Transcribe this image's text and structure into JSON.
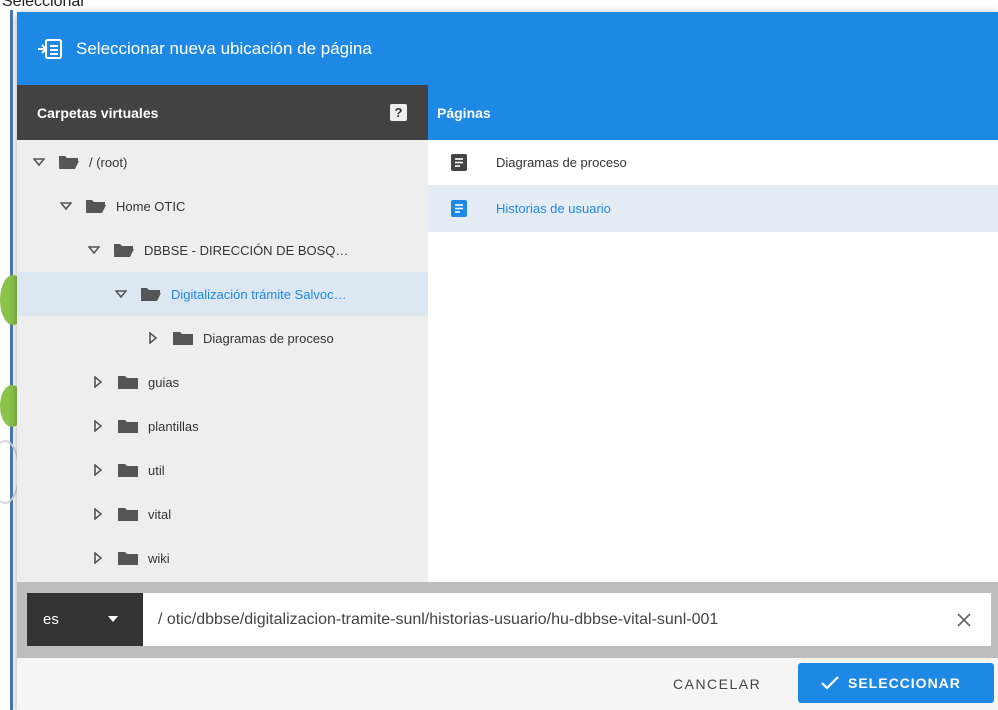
{
  "background": {
    "top_text": "Seleccionar"
  },
  "dialog": {
    "title": "Seleccionar nueva ubicación de página",
    "header_icon": "move-to-icon",
    "accent_color": "#1e88e5",
    "left_panel": {
      "title": "Carpetas virtuales",
      "help_label": "?"
    },
    "tree": [
      {
        "label": "/ (root)",
        "expanded": true,
        "icon": "folder-open-icon"
      },
      {
        "label": "Home OTIC",
        "expanded": true,
        "icon": "folder-open-icon"
      },
      {
        "label": "DBBSE - DIRECCIÓN DE BOSQUES, BI...",
        "expanded": true,
        "icon": "folder-open-icon"
      },
      {
        "label": "Digitalización trámite Salvocondu...",
        "expanded": true,
        "selected": true,
        "icon": "folder-open-icon"
      },
      {
        "label": "Diagramas de proceso",
        "expanded": false,
        "icon": "folder-icon"
      },
      {
        "label": "guias",
        "expanded": false,
        "icon": "folder-icon"
      },
      {
        "label": "plantillas",
        "expanded": false,
        "icon": "folder-icon"
      },
      {
        "label": "util",
        "expanded": false,
        "icon": "folder-icon"
      },
      {
        "label": "vital",
        "expanded": false,
        "icon": "folder-icon"
      },
      {
        "label": "wiki",
        "expanded": false,
        "icon": "folder-icon"
      }
    ],
    "right_panel": {
      "title": "Páginas"
    },
    "pages": [
      {
        "label": "Diagramas de proceso",
        "selected": false,
        "icon": "document-icon"
      },
      {
        "label": "Historias de usuario",
        "selected": true,
        "icon": "document-icon"
      }
    ],
    "locale": {
      "value": "es"
    },
    "path": {
      "value": "/ otic/dbbse/digitalizacion-tramite-sunl/historias-usuario/hu-dbbse-vital-sunl-001"
    },
    "footer": {
      "cancel_label": "CANCELAR",
      "select_label": "SELECCIONAR"
    }
  }
}
